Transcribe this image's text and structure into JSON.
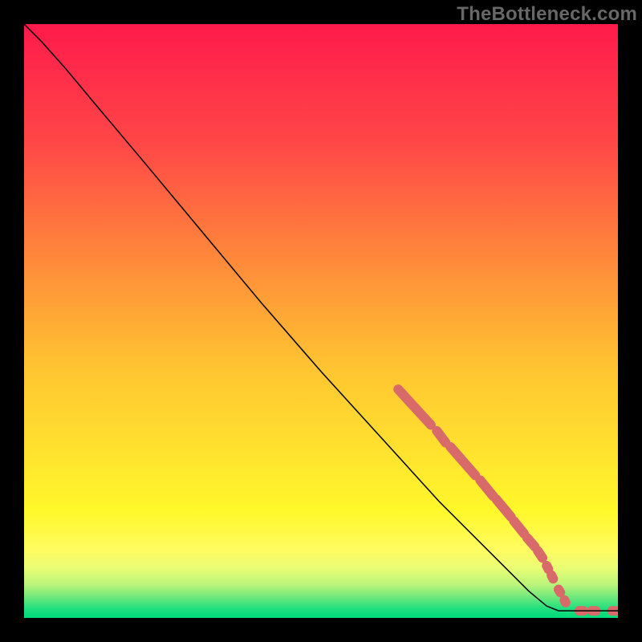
{
  "watermark": "TheBottleneck.com",
  "chart_data": {
    "type": "line",
    "title": "",
    "xlabel": "",
    "ylabel": "",
    "xlim": [
      0,
      100
    ],
    "ylim": [
      0,
      100
    ],
    "background_gradient": {
      "stops": [
        {
          "offset": 0.0,
          "color": "#ff1a4b"
        },
        {
          "offset": 0.2,
          "color": "#ff4747"
        },
        {
          "offset": 0.4,
          "color": "#ff8a3a"
        },
        {
          "offset": 0.58,
          "color": "#ffc531"
        },
        {
          "offset": 0.72,
          "color": "#ffe22e"
        },
        {
          "offset": 0.82,
          "color": "#fff82a"
        },
        {
          "offset": 0.885,
          "color": "#fffc60"
        },
        {
          "offset": 0.915,
          "color": "#ebfd74"
        },
        {
          "offset": 0.945,
          "color": "#b8f47a"
        },
        {
          "offset": 0.965,
          "color": "#6fe87c"
        },
        {
          "offset": 0.985,
          "color": "#1de07f"
        },
        {
          "offset": 1.0,
          "color": "#00d97a"
        }
      ]
    },
    "series": [
      {
        "name": "curve",
        "type": "line",
        "color": "#000000",
        "width": 1.5,
        "points": [
          {
            "x": 0.0,
            "y": 100.0
          },
          {
            "x": 3.0,
            "y": 97.0
          },
          {
            "x": 7.0,
            "y": 92.5
          },
          {
            "x": 12.0,
            "y": 86.5
          },
          {
            "x": 20.0,
            "y": 77.0
          },
          {
            "x": 30.0,
            "y": 65.0
          },
          {
            "x": 40.0,
            "y": 53.0
          },
          {
            "x": 50.0,
            "y": 41.5
          },
          {
            "x": 60.0,
            "y": 30.5
          },
          {
            "x": 70.0,
            "y": 19.5
          },
          {
            "x": 80.0,
            "y": 9.5
          },
          {
            "x": 85.0,
            "y": 4.5
          },
          {
            "x": 88.0,
            "y": 2.0
          },
          {
            "x": 90.0,
            "y": 1.2
          },
          {
            "x": 94.0,
            "y": 1.2
          },
          {
            "x": 100.0,
            "y": 1.2
          }
        ]
      },
      {
        "name": "marker-segments",
        "type": "segments",
        "color": "#d86a6a",
        "width": 12,
        "segments": [
          {
            "x1": 63.0,
            "y1": 38.5,
            "x2": 68.5,
            "y2": 32.5
          },
          {
            "x1": 69.5,
            "y1": 31.5,
            "x2": 71.0,
            "y2": 29.5
          },
          {
            "x1": 71.8,
            "y1": 28.8,
            "x2": 76.0,
            "y2": 24.0
          },
          {
            "x1": 76.8,
            "y1": 23.2,
            "x2": 79.0,
            "y2": 20.5
          },
          {
            "x1": 79.5,
            "y1": 20.0,
            "x2": 82.0,
            "y2": 17.0
          },
          {
            "x1": 82.5,
            "y1": 16.3,
            "x2": 84.2,
            "y2": 14.2
          },
          {
            "x1": 84.7,
            "y1": 13.5,
            "x2": 86.0,
            "y2": 12.0
          },
          {
            "x1": 86.5,
            "y1": 11.3,
            "x2": 87.3,
            "y2": 10.1
          },
          {
            "x1": 88.0,
            "y1": 8.8,
            "x2": 88.3,
            "y2": 8.2
          },
          {
            "x1": 88.8,
            "y1": 7.2,
            "x2": 89.1,
            "y2": 6.6
          },
          {
            "x1": 90.0,
            "y1": 4.8,
            "x2": 90.3,
            "y2": 4.3
          },
          {
            "x1": 91.0,
            "y1": 3.0,
            "x2": 91.2,
            "y2": 2.6
          },
          {
            "x1": 93.5,
            "y1": 1.2,
            "x2": 94.2,
            "y2": 1.2
          },
          {
            "x1": 95.6,
            "y1": 1.2,
            "x2": 96.3,
            "y2": 1.2
          },
          {
            "x1": 99.0,
            "y1": 1.2,
            "x2": 99.7,
            "y2": 1.2
          }
        ]
      }
    ]
  }
}
